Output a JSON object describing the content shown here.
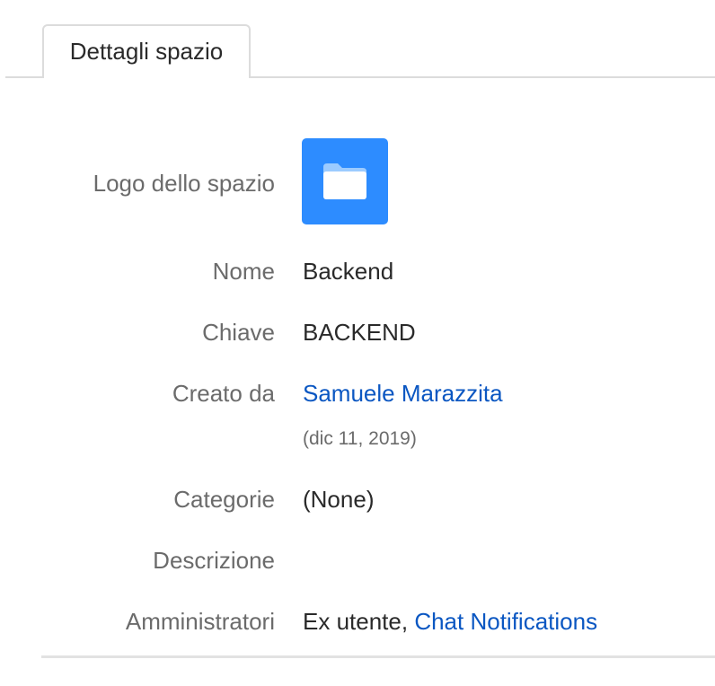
{
  "tabs": [
    {
      "label": "Dettagli spazio"
    }
  ],
  "details": {
    "logo_label": "Logo dello spazio",
    "logo_icon": "folder-icon",
    "logo_color": "#2d8cff",
    "name_label": "Nome",
    "name_value": "Backend",
    "key_label": "Chiave",
    "key_value": "BACKEND",
    "created_by_label": "Creato da",
    "created_by_user": "Samuele Marazzita",
    "created_date": "(dic 11, 2019)",
    "categories_label": "Categorie",
    "categories_value": "(None)",
    "description_label": "Descrizione",
    "description_value": "",
    "admins_label": "Amministratori",
    "admins_plain": "Ex utente, ",
    "admins_link": "Chat Notifications"
  },
  "colors": {
    "link": "#0b57c2",
    "label": "#6b6b6b",
    "text": "#2a2a2a"
  }
}
